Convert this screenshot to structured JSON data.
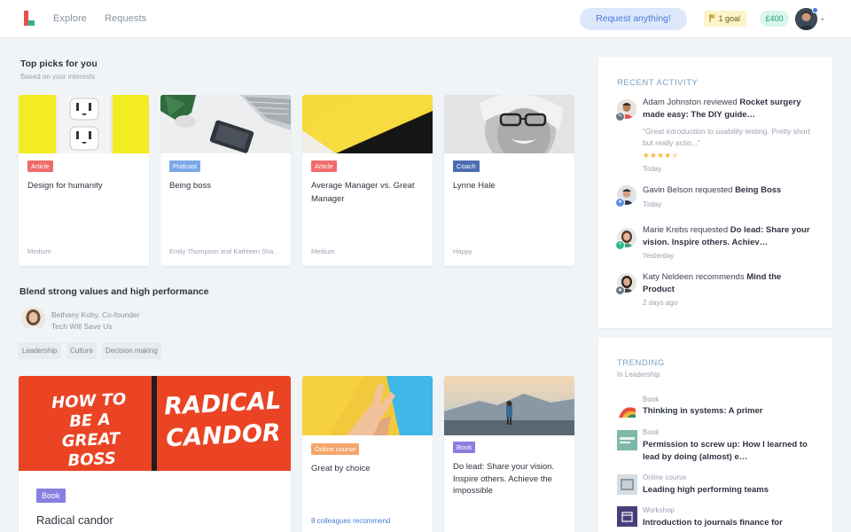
{
  "header": {
    "nav": [
      "Explore",
      "Requests"
    ],
    "request_button": "Request anything!",
    "goal": "1 goal",
    "balance": "£400"
  },
  "top_picks": {
    "title": "Top picks for you",
    "subtitle": "Based on your interests",
    "cards": [
      {
        "tag": "Article",
        "tag_color": "#f06c6c",
        "title": "Design for humanity",
        "meta": "Medium"
      },
      {
        "tag": "Podcast",
        "tag_color": "#7ba8e8",
        "title": "Being boss",
        "meta": "Emily Thompson and Kathleen Shannon"
      },
      {
        "tag": "Article",
        "tag_color": "#f06c6c",
        "title": "Average Manager vs. Great Manager",
        "meta": "Medium"
      },
      {
        "tag": "Coach",
        "tag_color": "#4a6fb0",
        "title": "Lynne Hale",
        "meta": "Happy"
      }
    ]
  },
  "blend": {
    "title": "Blend strong values and high performance",
    "author_name": "Bethany Koby, Co-founder",
    "author_company": "Tech Will Save Us",
    "chips": [
      "Leadership",
      "Culture",
      "Decision making"
    ],
    "cards": [
      {
        "tag": "Book",
        "tag_color": "#8a7fe0",
        "title": "Radical candor",
        "cover_left": "HOW TO BE A GREAT BOSS",
        "cover_right": "RADICAL CANDOR"
      },
      {
        "tag": "Online course",
        "tag_color": "#f4a66b",
        "title": "Great by choice",
        "meta": "8 colleagues recommend"
      },
      {
        "tag": "Book",
        "tag_color": "#8a7fe0",
        "title": "Do lead: Share your vision. Inspire others. Achieve the impossible"
      }
    ]
  },
  "recent_activity": {
    "title": "RECENT ACTIVITY",
    "items": [
      {
        "user": "Adam Johnston",
        "action": "reviewed",
        "target": "Rocket surgery made easy: The DIY guide…",
        "quote": "\"Great introduction to usability testing. Pretty short but really actio...\"",
        "rating": 4,
        "time": "Today"
      },
      {
        "user": "Gavin Belson",
        "action": "requested",
        "target": "Being Boss",
        "time": "Today"
      },
      {
        "user": "Marie Krebs",
        "action": "requested",
        "target": "Do lead: Share your vision. Inspire others. Achiev…",
        "time": "Yesterday"
      },
      {
        "user": "Katy Neldeen",
        "action": "recommends",
        "target": "Mind the Product",
        "time": "2 days ago"
      }
    ]
  },
  "trending": {
    "title": "TRENDING",
    "subtitle": "In Leadership",
    "items": [
      {
        "type": "Book",
        "title": "Thinking in systems: A primer"
      },
      {
        "type": "Book",
        "title": "Permission to screw up: How I learned to lead by doing (almost) e…"
      },
      {
        "type": "Online course",
        "title": "Leading high performing teams"
      },
      {
        "type": "Workshop",
        "title": "Introduction to journals finance for"
      }
    ]
  },
  "colors": {
    "accent": "#4a79d8",
    "background": "#f1f4f7"
  }
}
